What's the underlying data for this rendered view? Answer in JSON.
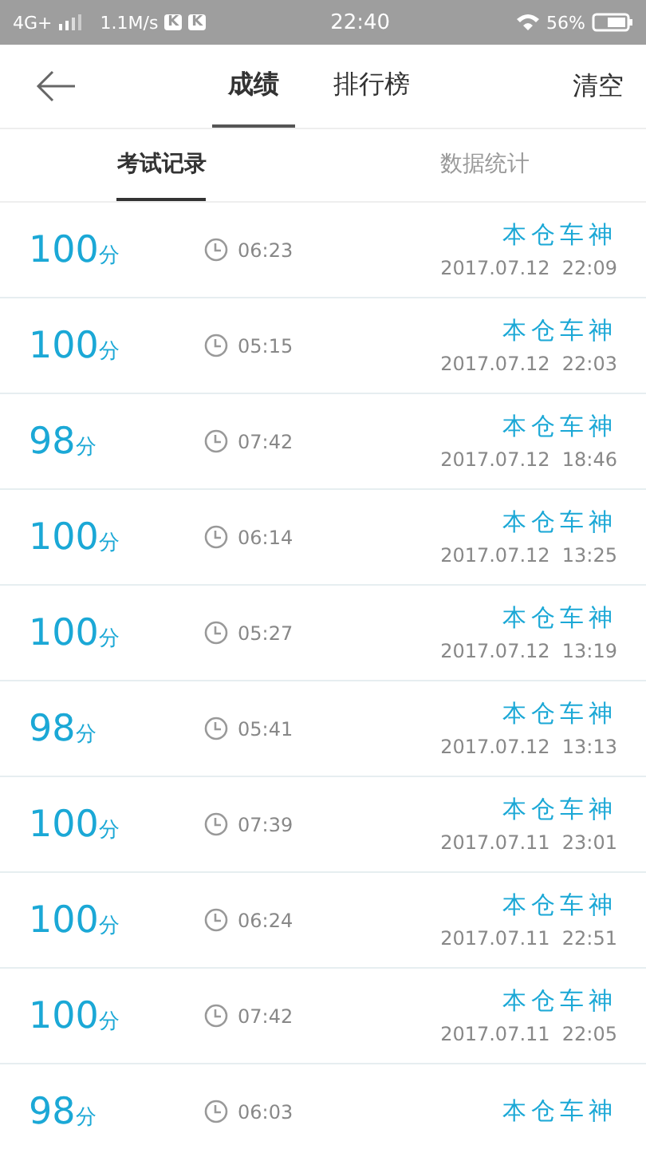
{
  "status_bar": {
    "network": "4G+",
    "speed": "1.1M/s",
    "app_badges": [
      "K",
      "K"
    ],
    "time": "22:40",
    "battery_text": "56%"
  },
  "nav": {
    "tabs": [
      {
        "label": "成绩",
        "selected": true
      },
      {
        "label": "排行榜",
        "selected": false
      }
    ],
    "action": "清空"
  },
  "sub_tabs": [
    {
      "label": "考试记录",
      "selected": true
    },
    {
      "label": "数据统计",
      "selected": false
    }
  ],
  "records": [
    {
      "score": "100",
      "unit": "分",
      "duration": "06:23",
      "title": "本仓车神",
      "datetime": "2017.07.12  22:09"
    },
    {
      "score": "100",
      "unit": "分",
      "duration": "05:15",
      "title": "本仓车神",
      "datetime": "2017.07.12  22:03"
    },
    {
      "score": "98",
      "unit": "分",
      "duration": "07:42",
      "title": "本仓车神",
      "datetime": "2017.07.12  18:46"
    },
    {
      "score": "100",
      "unit": "分",
      "duration": "06:14",
      "title": "本仓车神",
      "datetime": "2017.07.12  13:25"
    },
    {
      "score": "100",
      "unit": "分",
      "duration": "05:27",
      "title": "本仓车神",
      "datetime": "2017.07.12  13:19"
    },
    {
      "score": "98",
      "unit": "分",
      "duration": "05:41",
      "title": "本仓车神",
      "datetime": "2017.07.12  13:13"
    },
    {
      "score": "100",
      "unit": "分",
      "duration": "07:39",
      "title": "本仓车神",
      "datetime": "2017.07.11  23:01"
    },
    {
      "score": "100",
      "unit": "分",
      "duration": "06:24",
      "title": "本仓车神",
      "datetime": "2017.07.11  22:51"
    },
    {
      "score": "100",
      "unit": "分",
      "duration": "07:42",
      "title": "本仓车神",
      "datetime": "2017.07.11  22:05"
    },
    {
      "score": "98",
      "unit": "分",
      "duration": "06:03",
      "title": "本仓车神"
    }
  ]
}
